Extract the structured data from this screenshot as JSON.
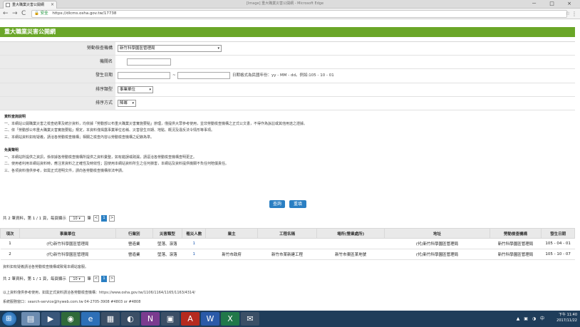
{
  "browser": {
    "tab_title": "重大職業災害公開網",
    "tab_close": "×",
    "window_center_title": "[Image] 重大職業災害公開網 - Microsoft Edge",
    "window_buttons": "－ □ ×",
    "secure_label": "安全",
    "url": "https://dlcms.osha.gov.tw/17738",
    "back": "←",
    "forward": "→",
    "reload": "C",
    "star": "☆",
    "menu": "⋮"
  },
  "header": {
    "title": "重大職業災害公開網"
  },
  "form": {
    "agency": {
      "label": "勞動檢查機構",
      "value": "新竹科學園區管理局",
      "caret": "▾"
    },
    "unit_name": {
      "label": "機關名",
      "value": ""
    },
    "date": {
      "label": "發生日期",
      "separator": "~",
      "hint": "日期格式為民國年份：yy - MM - dd。例如:105 - 10 - 01"
    },
    "sort_type": {
      "label": "排序類型",
      "value": "事業單位",
      "caret": "▾"
    },
    "sort_mode": {
      "label": "排序方式",
      "value": "降冪",
      "caret": "▾"
    }
  },
  "notes": {
    "heading1": "資料查詢說明",
    "lines1": [
      "一、本網站公開職業災害之檢查結果及統計資料，均依據「勞動部公布重大職業災害實施要點」辦理，僅提供大眾參考使用，並非勞動檢查機構之正式公文書，不得作為訴訟或其他用途之證據。",
      "二、依「勞動部公布重大職業災害實施要點」規定，本資料僅揭露事業單位名稱、災害發生日期、地點、概況及違反法令情形等事項。",
      "三、本網站資料如有疑義，請洽各勞動檢查機構；相關之檢查內容以勞動檢查機構之紀錄為準。"
    ],
    "heading2": "免責聲明",
    "lines2": [
      "一、本網站所提供之資訊，係依據各勞動檢查機構所提供之資料彙整，如有錯誤或疏漏，請逕洽各勞動檢查機構查明更正。",
      "二、使用者利用本網站資料時，應注意資料之正確性及時效性；因使用本網站資料所生之任何損害，本網站及資料提供機關不負任何賠償責任。",
      "三、各項資料僅供參考，如需正式證明文件，請向各勞動檢查機構依法申請。"
    ]
  },
  "buttons": {
    "search": "查詢",
    "clear": "重填"
  },
  "pager": {
    "summary": "共 2 筆資料，第 1 / 1 頁，每頁顯示",
    "page_size": "10",
    "caret": "▾",
    "unit": "筆",
    "prev": "<",
    "current": "1",
    "next": ">"
  },
  "table": {
    "headers": [
      "項次",
      "事業單位",
      "行業別",
      "災害類型",
      "罹災人數",
      "業主",
      "工程名稱",
      "場所(營業處所)",
      "地址",
      "勞動檢查機構",
      "發生日期"
    ],
    "rows": [
      [
        "1",
        "(代)新竹科學園區管理局",
        "(代)新竹科學園區管理局",
        "營造業",
        "墜落、滾落",
        "1",
        "",
        "",
        "",
        "(代)新竹科學園區管理局",
        "新竹科學園區管理局",
        "105 - 04 - 01"
      ],
      [
        "2",
        "(代)新竹科學園區管理局",
        "(代)新竹科學園區管理局",
        "營造業",
        "墜落、滾落",
        "1",
        "新竹市政府",
        "新竹市某新建工程",
        "新竹市東區某地號",
        "(代)新竹科學園區管理局",
        "新竹科學園區管理局",
        "105 - 10 - 07"
      ]
    ]
  },
  "row_note": "資料如有疑義請洽各勞動檢查機構或致電本網站客服。",
  "footer": {
    "line1": "以上資料僅供參考使用，如需正式資料請洽各勞動檢查機構：https://www.osha.gov.tw/1106/1164/1165/1163/4314/",
    "line2": "系統服務窗口：search-service@hyweb.com.tw  04-2705-3908 #4803 or #4808"
  },
  "taskbar": {
    "start_icon": "⊞",
    "clock_time": "下午 11:40",
    "clock_date": "2017/11/22",
    "tray": "▲ ▣ ◑ 中"
  }
}
